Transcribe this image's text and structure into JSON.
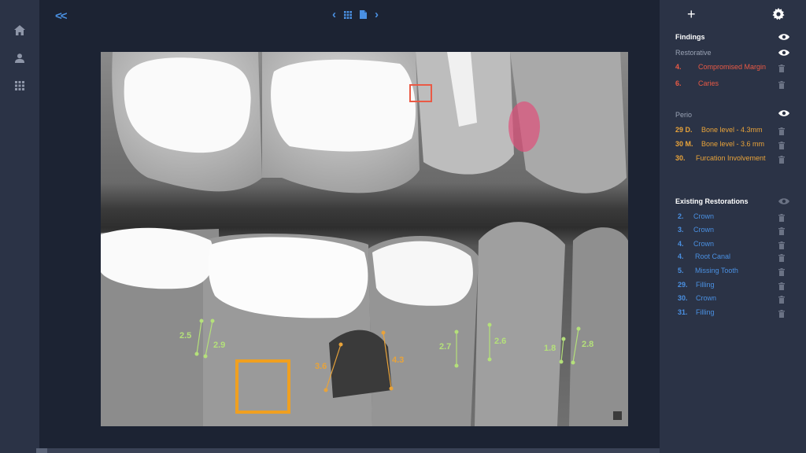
{
  "viewer": {
    "collapse_label": "<<",
    "pager": {
      "prev": "‹",
      "next": "›"
    }
  },
  "measurements": [
    {
      "label": "2.5",
      "color": "#b4e07a"
    },
    {
      "label": "2.9",
      "color": "#b4e07a"
    },
    {
      "label": "3.6",
      "color": "#e8a33a"
    },
    {
      "label": "4.3",
      "color": "#e8a33a"
    },
    {
      "label": "2.7",
      "color": "#b4e07a"
    },
    {
      "label": "2.6",
      "color": "#b4e07a"
    },
    {
      "label": "1.8",
      "color": "#b4e07a"
    },
    {
      "label": "2.8",
      "color": "#b4e07a"
    }
  ],
  "panel": {
    "add_label": "+",
    "findings_title": "Findings",
    "restorative_title": "Restorative",
    "restorative": [
      {
        "num": "4.",
        "label": "Compromised Margin"
      },
      {
        "num": "6.",
        "label": "Caries"
      }
    ],
    "perio_title": "Perio",
    "perio": [
      {
        "num": "29 D.",
        "label": "Bone level - 4.3mm"
      },
      {
        "num": "30 M.",
        "label": "Bone level - 3.6 mm"
      },
      {
        "num": "30.",
        "label": "Furcation Involvement"
      }
    ],
    "existing_title": "Existing Restorations",
    "existing": [
      {
        "num": "2.",
        "label": "Crown"
      },
      {
        "num": "3.",
        "label": "Crown"
      },
      {
        "num": "4.",
        "label": "Crown"
      },
      {
        "num": "4.",
        "label": "Root Canal"
      },
      {
        "num": "5.",
        "label": "Missing Tooth"
      },
      {
        "num": "29.",
        "label": "Filling"
      },
      {
        "num": "30.",
        "label": "Crown"
      },
      {
        "num": "31.",
        "label": "Filling"
      }
    ]
  },
  "colors": {
    "accent": "#4a90e2",
    "restorative": "#ea5a45",
    "perio": "#e8a33a",
    "measure_green": "#b4e07a"
  }
}
